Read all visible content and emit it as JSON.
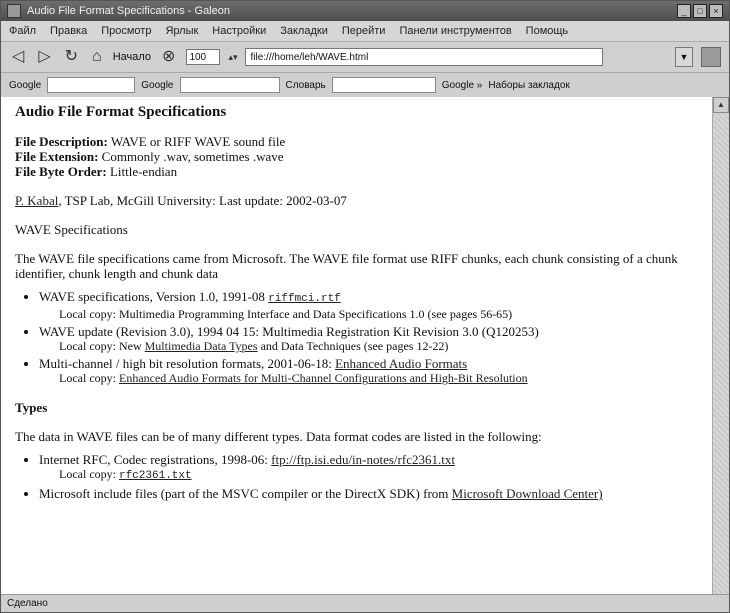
{
  "window": {
    "title": "Audio File Format Specifications - Galeon"
  },
  "menu": [
    "Файл",
    "Правка",
    "Просмотр",
    "Ярлык",
    "Настройки",
    "Закладки",
    "Перейти",
    "Панели инструментов",
    "Помощь"
  ],
  "toolbar": {
    "home_label": "Начало",
    "zoom": "100",
    "url": "file:///home/leh/WAVE.html"
  },
  "searchbar": {
    "google1": "Google",
    "google2": "Google",
    "dict": "Словарь",
    "google3": "Google »",
    "bookmarks": "Наборы закладок"
  },
  "page": {
    "title": "Audio File Format Specifications",
    "desc_label": "File Description:",
    "desc_value": "WAVE or RIFF WAVE sound file",
    "ext_label": "File Extension:",
    "ext_value": "Commonly .wav, sometimes .wave",
    "order_label": "File Byte Order:",
    "order_value": "Little-endian",
    "author_link": "P. Kabal",
    "author_rest": ", TSP Lab, McGill University: Last update: 2002-03-07",
    "wave_heading": "WAVE Specifications",
    "wave_intro": "The WAVE file specifications came from Microsoft. The WAVE file format use RIFF chunks, each chunk consisting of a chunk identifier, chunk length and chunk data",
    "spec_items": [
      {
        "text": "WAVE specifications, Version 1.0, 1991-08",
        "link": "riffmci.rtf",
        "sub": "Local copy: Multimedia Programming Interface and Data Specifications 1.0 (see pages 56-65)"
      },
      {
        "text": "WAVE update (Revision 3.0), 1994 04 15: Multimedia Registration Kit Revision 3.0 (Q120253)",
        "link": "",
        "sub_pre": "Local copy: New",
        "sub_link": "Multimedia Data Types",
        "sub_post": "and Data Techniques (see pages 12-22)"
      },
      {
        "text": "Multi-channel / high bit resolution formats, 2001-06-18:",
        "link": "Enhanced Audio Formats",
        "sub_pre": "Local copy:",
        "sub_link": "Enhanced Audio Formats for Multi-Channel Configurations and High-Bit Resolution",
        "sub_post": ""
      }
    ],
    "types_heading": "Types",
    "types_intro": "The data in WAVE files can be of many different types. Data format codes are listed in the following:",
    "type_items": [
      {
        "text": "Internet RFC, Codec registrations, 1998-06:",
        "link": "ftp://ftp.isi.edu/in-notes/rfc2361.txt",
        "sub_pre": "Local copy:",
        "sub_link": "rfc2361.txt"
      },
      {
        "text": "Microsoft include files (part of the MSVC compiler or the DirectX SDK) from",
        "link": "Microsoft Download Center)"
      }
    ]
  },
  "status": "Сделано"
}
